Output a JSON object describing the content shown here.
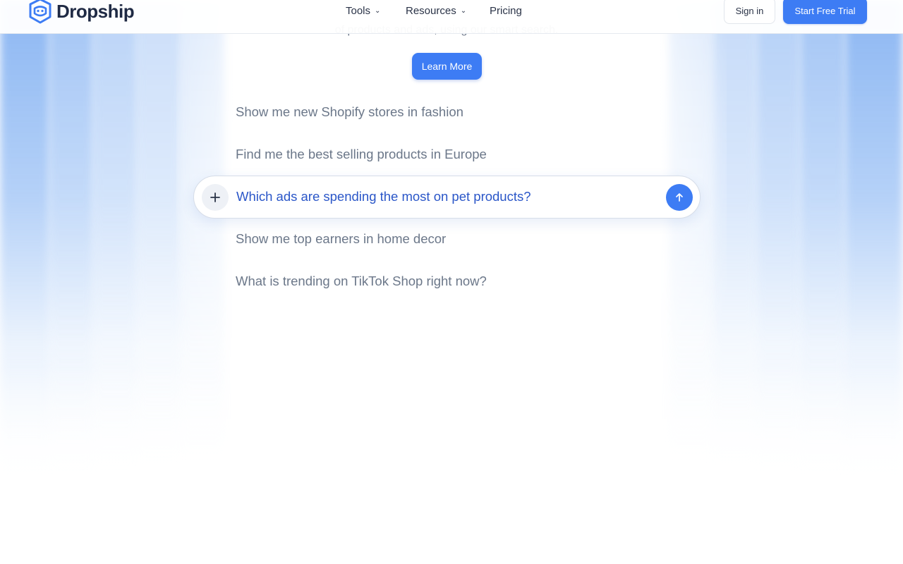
{
  "brand": {
    "name": "Dropship",
    "color": "#3d7cf4"
  },
  "nav": {
    "items": [
      {
        "label": "Tools",
        "has_dropdown": true
      },
      {
        "label": "Resources",
        "has_dropdown": true
      },
      {
        "label": "Pricing",
        "has_dropdown": false
      }
    ],
    "sign_in": "Sign in",
    "start_trial": "Start Free Trial"
  },
  "hero": {
    "subtitle_partial": "of products and ads, using our smart search.",
    "learn_more": "Learn More"
  },
  "suggestions": [
    "Show me new Shopify stores in fashion",
    "Find me the best selling products in Europe",
    "Show me top earners in home decor",
    "What is trending on TikTok Shop right now?"
  ],
  "search": {
    "value": "Which ads are spending the most on pet products?",
    "plus_icon": "plus-icon",
    "send_icon": "arrow-up-icon"
  }
}
